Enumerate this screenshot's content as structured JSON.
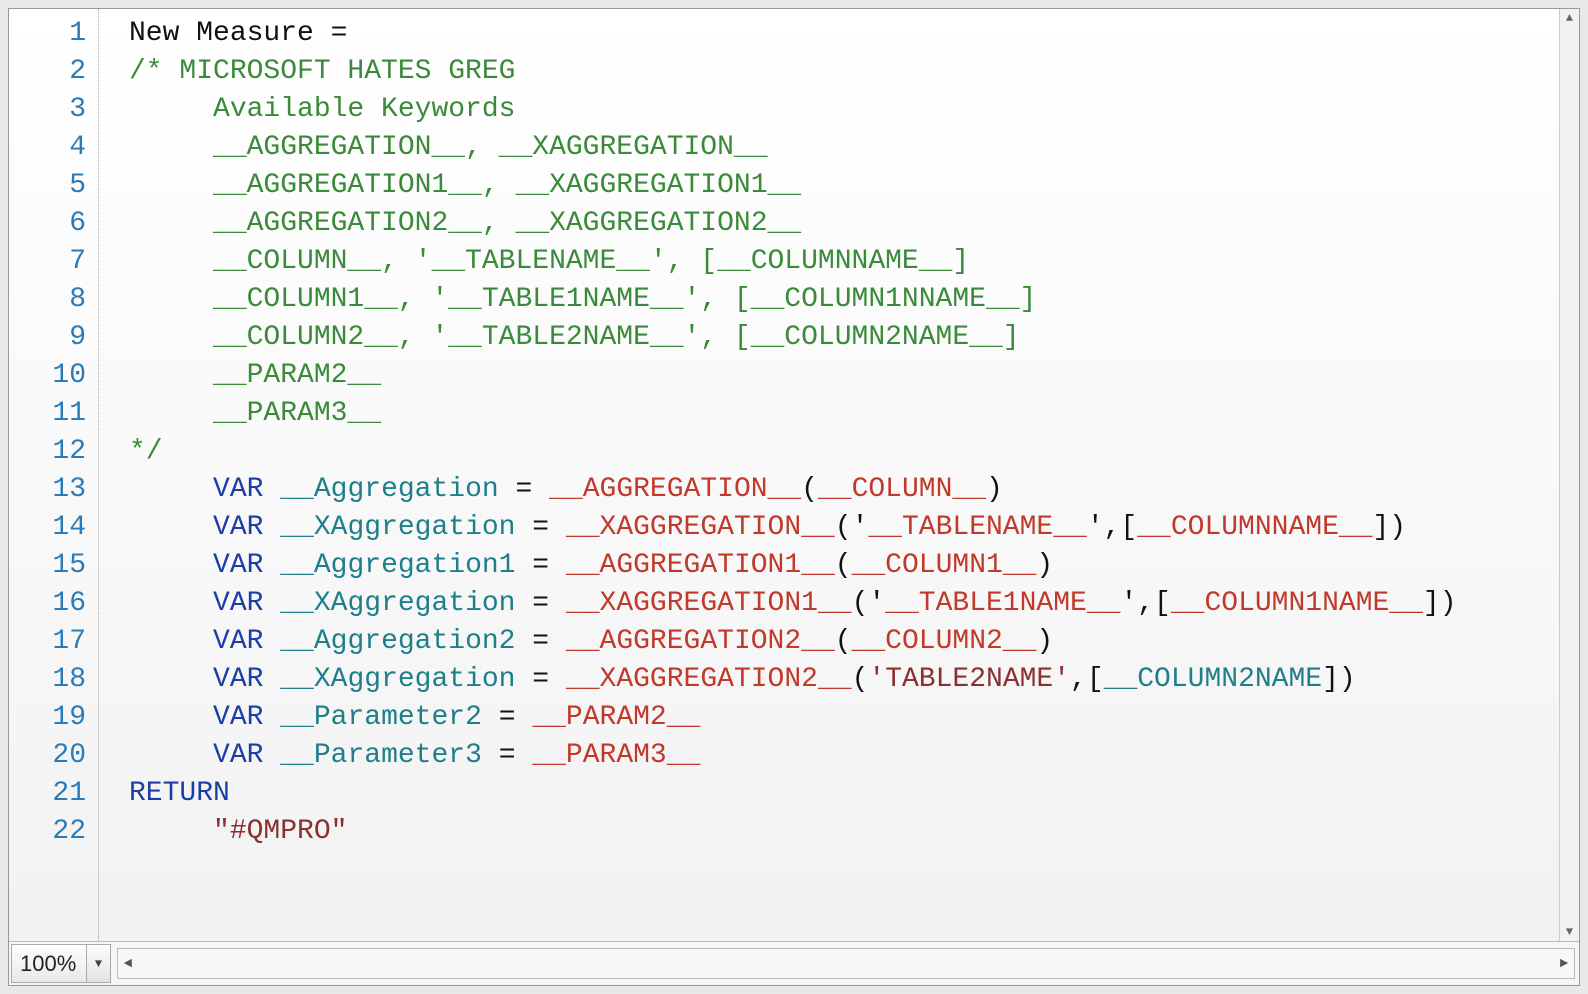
{
  "zoom": "100%",
  "lineCount": 22,
  "code": [
    [
      [
        "plain",
        "New Measure ="
      ]
    ],
    [
      [
        "comment",
        "/* MICROSOFT HATES GREG"
      ]
    ],
    [
      [
        "comment",
        "     Available Keywords"
      ]
    ],
    [
      [
        "comment",
        "     __AGGREGATION__, __XAGGREGATION__"
      ]
    ],
    [
      [
        "comment",
        "     __AGGREGATION1__, __XAGGREGATION1__"
      ]
    ],
    [
      [
        "comment",
        "     __AGGREGATION2__, __XAGGREGATION2__"
      ]
    ],
    [
      [
        "comment",
        "     __COLUMN__, '__TABLENAME__', [__COLUMNNAME__]"
      ]
    ],
    [
      [
        "comment",
        "     __COLUMN1__, '__TABLE1NAME__', [__COLUMN1NNAME__]"
      ]
    ],
    [
      [
        "comment",
        "     __COLUMN2__, '__TABLE2NAME__', [__COLUMN2NAME__]"
      ]
    ],
    [
      [
        "comment",
        "     __PARAM2__"
      ]
    ],
    [
      [
        "comment",
        "     __PARAM3__"
      ]
    ],
    [
      [
        "comment",
        "*/"
      ]
    ],
    [
      [
        "plain",
        "     "
      ],
      [
        "keyword",
        "VAR"
      ],
      [
        "plain",
        " "
      ],
      [
        "var",
        "__Aggregation"
      ],
      [
        "plain",
        " = "
      ],
      [
        "token",
        "__AGGREGATION__"
      ],
      [
        "plain",
        "("
      ],
      [
        "token",
        "__COLUMN__"
      ],
      [
        "plain",
        ")"
      ]
    ],
    [
      [
        "plain",
        "     "
      ],
      [
        "keyword",
        "VAR"
      ],
      [
        "plain",
        " "
      ],
      [
        "var",
        "__XAggregation"
      ],
      [
        "plain",
        " = "
      ],
      [
        "token",
        "__XAGGREGATION__"
      ],
      [
        "plain",
        "('"
      ],
      [
        "token",
        "__TABLENAME__"
      ],
      [
        "plain",
        "',["
      ],
      [
        "token",
        "__COLUMNNAME__"
      ],
      [
        "plain",
        "])"
      ]
    ],
    [
      [
        "plain",
        "     "
      ],
      [
        "keyword",
        "VAR"
      ],
      [
        "plain",
        " "
      ],
      [
        "var",
        "__Aggregation1"
      ],
      [
        "plain",
        " = "
      ],
      [
        "token",
        "__AGGREGATION1__"
      ],
      [
        "plain",
        "("
      ],
      [
        "token",
        "__COLUMN1__"
      ],
      [
        "plain",
        ")"
      ]
    ],
    [
      [
        "plain",
        "     "
      ],
      [
        "keyword",
        "VAR"
      ],
      [
        "plain",
        " "
      ],
      [
        "var",
        "__XAggregation"
      ],
      [
        "plain",
        " = "
      ],
      [
        "token",
        "__XAGGREGATION1__"
      ],
      [
        "plain",
        "('"
      ],
      [
        "token",
        "__TABLE1NAME__"
      ],
      [
        "plain",
        "',["
      ],
      [
        "token",
        "__COLUMN1NAME__"
      ],
      [
        "plain",
        "])"
      ]
    ],
    [
      [
        "plain",
        "     "
      ],
      [
        "keyword",
        "VAR"
      ],
      [
        "plain",
        " "
      ],
      [
        "var",
        "__Aggregation2"
      ],
      [
        "plain",
        " = "
      ],
      [
        "token",
        "__AGGREGATION2__"
      ],
      [
        "plain",
        "("
      ],
      [
        "token",
        "__COLUMN2__"
      ],
      [
        "plain",
        ")"
      ]
    ],
    [
      [
        "plain",
        "     "
      ],
      [
        "keyword",
        "VAR"
      ],
      [
        "plain",
        " "
      ],
      [
        "var",
        "__XAggregation"
      ],
      [
        "plain",
        " = "
      ],
      [
        "token",
        "__XAGGREGATION2__"
      ],
      [
        "plain",
        "("
      ],
      [
        "string",
        "'TABLE2NAME'"
      ],
      [
        "plain",
        ",["
      ],
      [
        "var",
        "__COLUMN2NAME"
      ],
      [
        "plain",
        "])"
      ]
    ],
    [
      [
        "plain",
        "     "
      ],
      [
        "keyword",
        "VAR"
      ],
      [
        "plain",
        " "
      ],
      [
        "var",
        "__Parameter2"
      ],
      [
        "plain",
        " = "
      ],
      [
        "token",
        "__PARAM2__"
      ]
    ],
    [
      [
        "plain",
        "     "
      ],
      [
        "keyword",
        "VAR"
      ],
      [
        "plain",
        " "
      ],
      [
        "var",
        "__Parameter3"
      ],
      [
        "plain",
        " = "
      ],
      [
        "token",
        "__PARAM3__"
      ]
    ],
    [
      [
        "keyword",
        "RETURN"
      ]
    ],
    [
      [
        "plain",
        "     "
      ],
      [
        "string",
        "\"#QMPRO\""
      ]
    ]
  ]
}
